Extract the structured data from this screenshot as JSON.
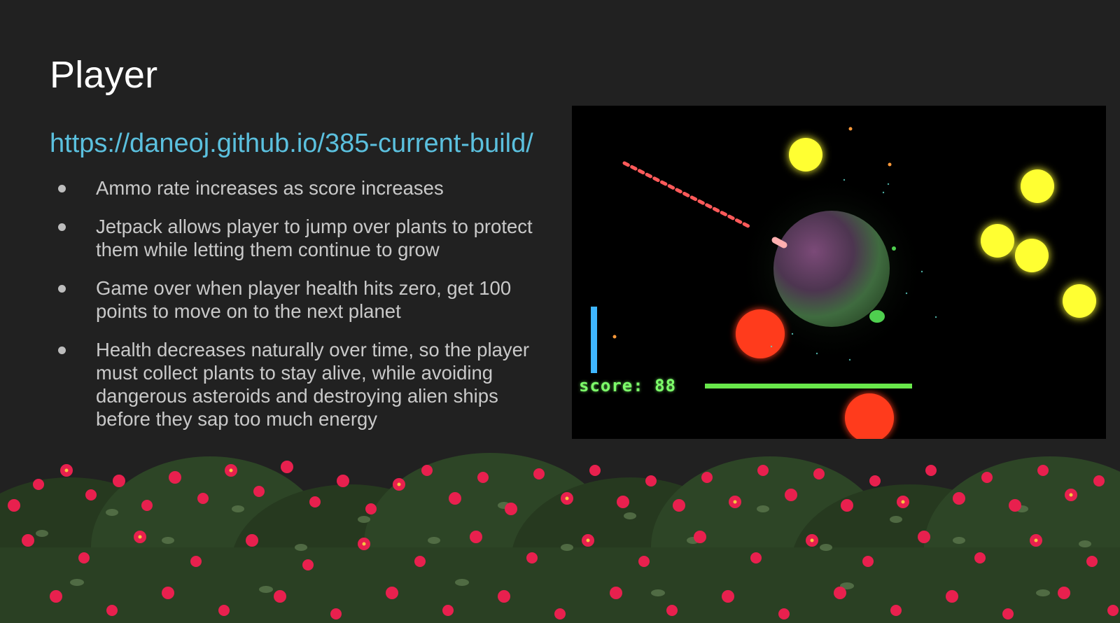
{
  "slide": {
    "title": "Player",
    "link": "https://daneoj.github.io/385-current-build/",
    "bullets": [
      "Ammo rate increases as score increases",
      "Jetpack allows player to jump over plants to protect them while letting them continue to grow",
      "Game over when player health hits zero, get 100 points to move on to the next planet",
      "Health decreases naturally over time, so the player must collect plants to stay alive, while avoiding dangerous asteroids and destroying alien ships before they sap too much energy"
    ]
  },
  "game": {
    "score_label": "score: 88",
    "score": 88,
    "colors": {
      "background": "#000000",
      "health_bar": "#69e84b",
      "ammo_bar": "#3fb6ff",
      "asteroid": "#ff3b1f",
      "energy_orb": "#ffff33",
      "laser": "#ff5a5a"
    }
  },
  "colors": {
    "slide_background": "#212121",
    "title": "#ffffff",
    "link": "#5bc0de",
    "body_text": "#c9c9c9",
    "flower_petal": "#e8204e",
    "foliage": "#2f4a2a"
  }
}
